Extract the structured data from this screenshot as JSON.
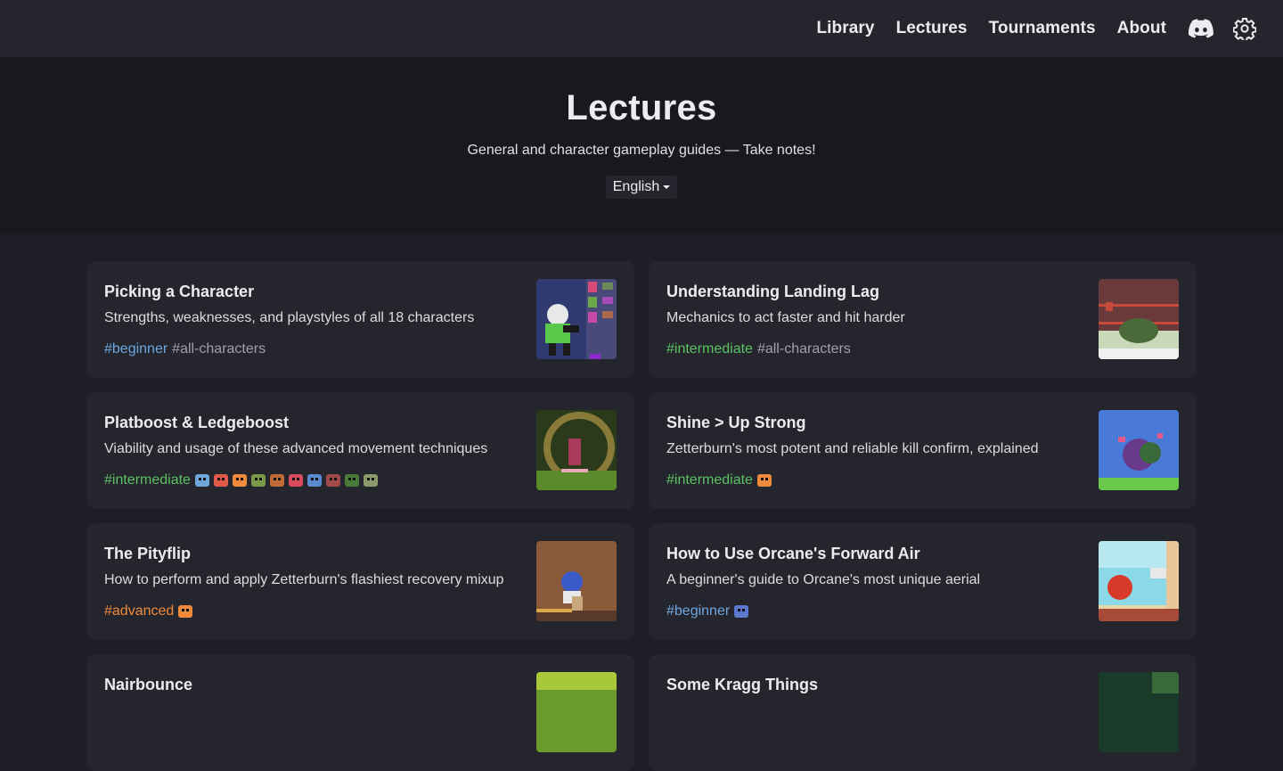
{
  "nav": {
    "links": [
      "Library",
      "Lectures",
      "Tournaments",
      "About"
    ],
    "discord_icon": "discord-icon",
    "settings_icon": "gear-icon"
  },
  "hero": {
    "title": "Lectures",
    "subtitle": "General and character gameplay guides — Take notes!",
    "language": "English"
  },
  "colors": {
    "beginner": "#6ea8e0",
    "intermediate": "#5cc264",
    "advanced": "#f08a3c",
    "plain_tag": "#a0a0a8"
  },
  "cards": [
    {
      "title": "Picking a Character",
      "description": "Strengths, weaknesses, and playstyles of all 18 characters",
      "tags": [
        {
          "text": "#beginner",
          "level": "beginner"
        },
        {
          "text": "#all-characters",
          "level": "plain"
        }
      ],
      "character_icons": [],
      "thumbnail": "tier-list-thumbnail"
    },
    {
      "title": "Understanding Landing Lag",
      "description": "Mechanics to act faster and hit harder",
      "tags": [
        {
          "text": "#intermediate",
          "level": "intermediate"
        },
        {
          "text": "#all-characters",
          "level": "plain"
        }
      ],
      "character_icons": [],
      "thumbnail": "landing-lag-thumbnail"
    },
    {
      "title": "Platboost & Ledgeboost",
      "description": "Viability and usage of these advanced movement techniques",
      "tags": [
        {
          "text": "#intermediate",
          "level": "intermediate"
        }
      ],
      "character_icons": [
        "#6fa8d8",
        "#e05a4a",
        "#f08a3c",
        "#7a9a4a",
        "#c06a3a",
        "#d84a5a",
        "#5a8ad0",
        "#a04a4a",
        "#4a7a3a",
        "#8a9a6a"
      ],
      "thumbnail": "platboost-thumbnail"
    },
    {
      "title": "Shine > Up Strong",
      "description": "Zetterburn's most potent and reliable kill confirm, explained",
      "tags": [
        {
          "text": "#intermediate",
          "level": "intermediate"
        }
      ],
      "character_icons": [
        "#f08a3c"
      ],
      "thumbnail": "shine-thumbnail"
    },
    {
      "title": "The Pityflip",
      "description": "How to perform and apply Zetterburn's flashiest recovery mixup",
      "tags": [
        {
          "text": "#advanced",
          "level": "advanced"
        }
      ],
      "character_icons": [
        "#f08a3c"
      ],
      "thumbnail": "pityflip-thumbnail"
    },
    {
      "title": "How to Use Orcane's Forward Air",
      "description": "A beginner's guide to Orcane's most unique aerial",
      "tags": [
        {
          "text": "#beginner",
          "level": "beginner"
        }
      ],
      "character_icons": [
        "#5a7ad0"
      ],
      "thumbnail": "orcane-thumbnail"
    },
    {
      "title": "Nairbounce",
      "description": "",
      "tags": [],
      "character_icons": [],
      "thumbnail": "nairbounce-thumbnail"
    },
    {
      "title": "Some Kragg Things",
      "description": "",
      "tags": [],
      "character_icons": [],
      "thumbnail": "kragg-thumbnail"
    }
  ]
}
